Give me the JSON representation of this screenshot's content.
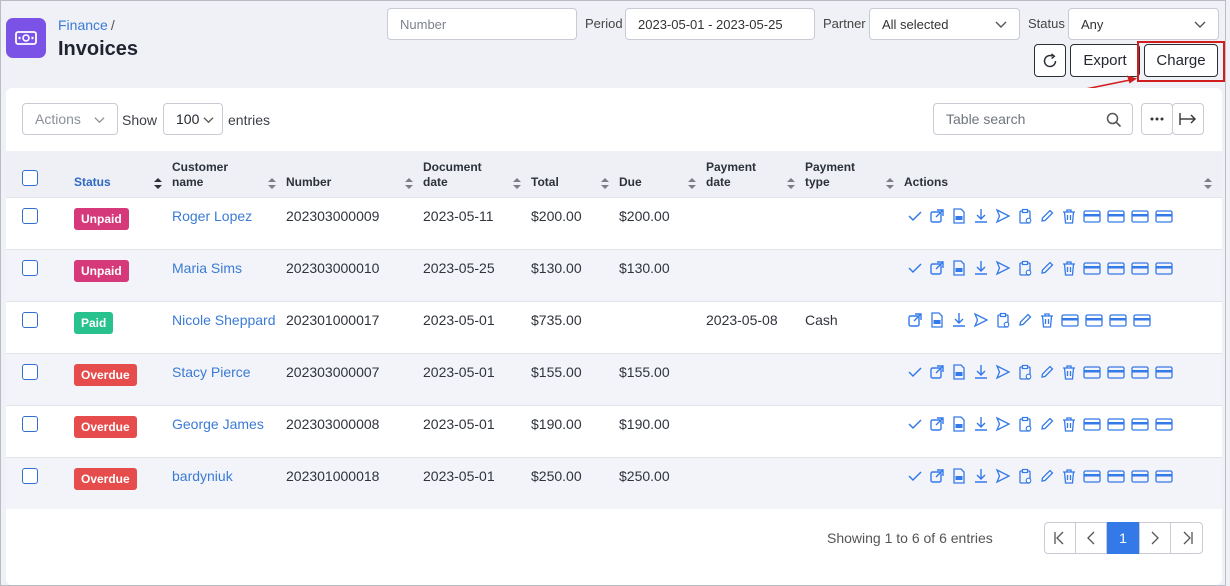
{
  "breadcrumb": {
    "parent": "Finance",
    "separator": "/"
  },
  "page_title": "Invoices",
  "filters": {
    "number_placeholder": "Number",
    "period_label": "Period",
    "period_value": "2023-05-01 - 2023-05-25",
    "partner_label": "Partner",
    "partner_value": "All selected",
    "status_label": "Status",
    "status_value": "Any"
  },
  "toolbar": {
    "export_label": "Export",
    "charge_label": "Charge"
  },
  "table_controls": {
    "actions_label": "Actions",
    "show_label": "Show",
    "page_size": "100",
    "entries_label": "entries",
    "search_placeholder": "Table search"
  },
  "columns": [
    "Status",
    "Customer name",
    "Number",
    "Document date",
    "Total",
    "Due",
    "Payment date",
    "Payment type",
    "Actions"
  ],
  "rows": [
    {
      "status": "Unpaid",
      "customer": "Roger Lopez",
      "number": "202303000009",
      "doc_date": "2023-05-11",
      "total": "$200.00",
      "due": "$200.00",
      "pay_date": "",
      "pay_type": ""
    },
    {
      "status": "Unpaid",
      "customer": "Maria Sims",
      "number": "202303000010",
      "doc_date": "2023-05-25",
      "total": "$130.00",
      "due": "$130.00",
      "pay_date": "",
      "pay_type": ""
    },
    {
      "status": "Paid",
      "customer": "Nicole Sheppard",
      "number": "202301000017",
      "doc_date": "2023-05-01",
      "total": "$735.00",
      "due": "",
      "pay_date": "2023-05-08",
      "pay_type": "Cash"
    },
    {
      "status": "Overdue",
      "customer": "Stacy Pierce",
      "number": "202303000007",
      "doc_date": "2023-05-01",
      "total": "$155.00",
      "due": "$155.00",
      "pay_date": "",
      "pay_type": ""
    },
    {
      "status": "Overdue",
      "customer": "George James",
      "number": "202303000008",
      "doc_date": "2023-05-01",
      "total": "$190.00",
      "due": "$190.00",
      "pay_date": "",
      "pay_type": ""
    },
    {
      "status": "Overdue",
      "customer": "bardyniuk",
      "number": "202301000018",
      "doc_date": "2023-05-01",
      "total": "$250.00",
      "due": "$250.00",
      "pay_date": "",
      "pay_type": ""
    }
  ],
  "footer": {
    "info": "Showing 1 to 6 of 6 entries",
    "current_page": "1"
  },
  "colors": {
    "unpaid": "#d6397a",
    "paid": "#27c28d",
    "overdue": "#e64c4c",
    "link": "#3a7bd5",
    "accent": "#3479e8",
    "brand": "#7a53e6",
    "highlight": "#d11d1d"
  }
}
